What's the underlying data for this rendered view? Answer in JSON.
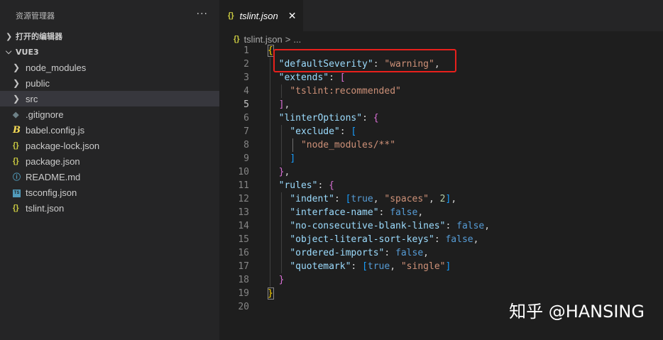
{
  "sidebar": {
    "title": "资源管理器",
    "more": "···",
    "open_editors": "打开的编辑器",
    "project": "VUE3",
    "items": [
      {
        "label": "node_modules",
        "type": "folder",
        "icon": "chevron-right-icon"
      },
      {
        "label": "public",
        "type": "folder",
        "icon": "chevron-right-icon"
      },
      {
        "label": "src",
        "type": "folder",
        "icon": "chevron-right-icon",
        "selected": true
      },
      {
        "label": ".gitignore",
        "type": "file",
        "icon": "git-icon",
        "glyph": "◆"
      },
      {
        "label": "babel.config.js",
        "type": "file",
        "icon": "babel-icon",
        "glyph": "B"
      },
      {
        "label": "package-lock.json",
        "type": "file",
        "icon": "json-icon",
        "glyph": "{}"
      },
      {
        "label": "package.json",
        "type": "file",
        "icon": "json-icon",
        "glyph": "{}"
      },
      {
        "label": "README.md",
        "type": "file",
        "icon": "info-icon",
        "glyph": "ⓘ"
      },
      {
        "label": "tsconfig.json",
        "type": "file",
        "icon": "ts-icon",
        "glyph": "TS"
      },
      {
        "label": "tslint.json",
        "type": "file",
        "icon": "json-icon",
        "glyph": "{}"
      }
    ]
  },
  "editor": {
    "tab_label": "tslint.json",
    "tab_icon": "{}",
    "tab_close": "✕",
    "breadcrumb_file": "tslint.json",
    "breadcrumb_sep": ">",
    "breadcrumb_more": "...",
    "active_line": 5,
    "line_numbers": [
      "1",
      "2",
      "3",
      "4",
      "5",
      "6",
      "7",
      "8",
      "9",
      "10",
      "11",
      "12",
      "13",
      "14",
      "15",
      "16",
      "17",
      "18",
      "19",
      "20"
    ]
  },
  "watermark": "知乎 @HANSING",
  "colors": {
    "highlight_box": "#e8201c",
    "key": "#9cdcfe",
    "string": "#ce9178",
    "keyword": "#569cd6",
    "number": "#b5cea8"
  }
}
